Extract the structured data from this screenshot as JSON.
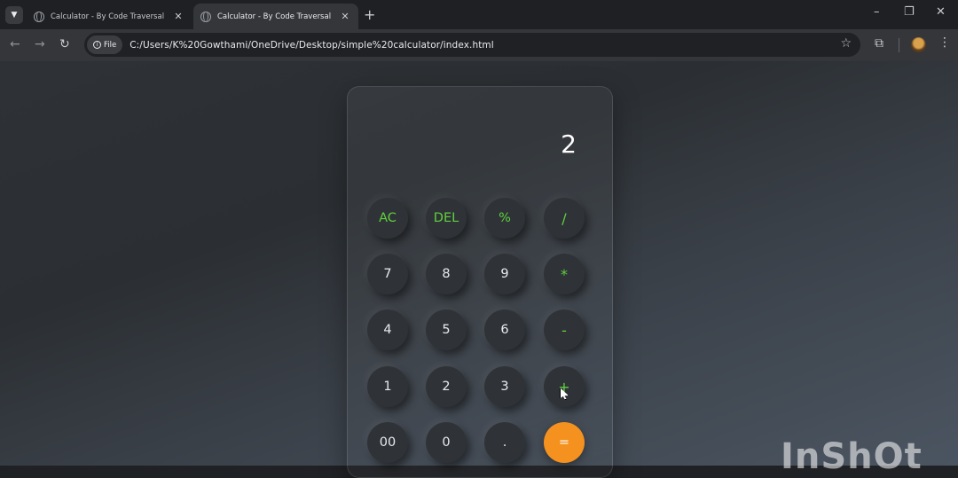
{
  "browser": {
    "tabs": [
      {
        "title": "Calculator - By Code Traversal",
        "active": false
      },
      {
        "title": "Calculator - By Code Traversal",
        "active": true
      }
    ],
    "new_tab_label": "+",
    "site_info_label": "File",
    "url": "C:/Users/K%20Gowthami/OneDrive/Desktop/simple%20calculator/index.html"
  },
  "calculator": {
    "display": "2",
    "buttons": {
      "ac": "AC",
      "del": "DEL",
      "percent": "%",
      "divide": "/",
      "seven": "7",
      "eight": "8",
      "nine": "9",
      "multiply": "*",
      "four": "4",
      "five": "5",
      "six": "6",
      "subtract": "-",
      "one": "1",
      "two": "2",
      "three": "3",
      "add": "+",
      "double_zero": "00",
      "zero": "0",
      "decimal": ".",
      "equals": "="
    },
    "colors": {
      "operator": "#5fd03c",
      "equals_bg": "#f5921f"
    }
  },
  "watermark": "InShOt"
}
